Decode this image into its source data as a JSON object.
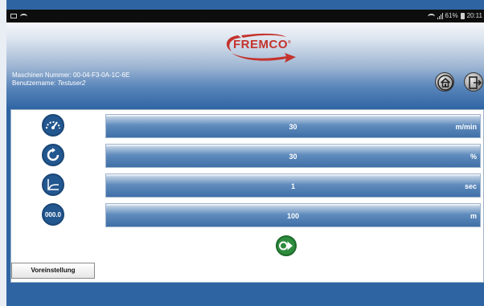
{
  "statusbar": {
    "battery": "61%",
    "time": "20:11"
  },
  "header": {
    "logo_text": "FREMCO",
    "logo_mark": "®",
    "machine_label": "Maschinen Nummer:",
    "machine_number": "00-04-F3-0A-1C-6E",
    "user_label": "Benutzername:",
    "user_name": "Testuser2"
  },
  "rows": [
    {
      "icon": "speedometer-icon",
      "value": "30",
      "unit": "m/min"
    },
    {
      "icon": "rotate-icon",
      "value": "30",
      "unit": "%"
    },
    {
      "icon": "graph-icon",
      "value": "1",
      "unit": "sec"
    },
    {
      "icon": "counter-icon",
      "icon_text": "000.0",
      "value": "100",
      "unit": "m"
    }
  ],
  "preset_button": "Voreinstellung",
  "colors": {
    "brand_red": "#c4332c",
    "primary_blue": "#2f64a3",
    "start_green": "#2e8b3e"
  }
}
